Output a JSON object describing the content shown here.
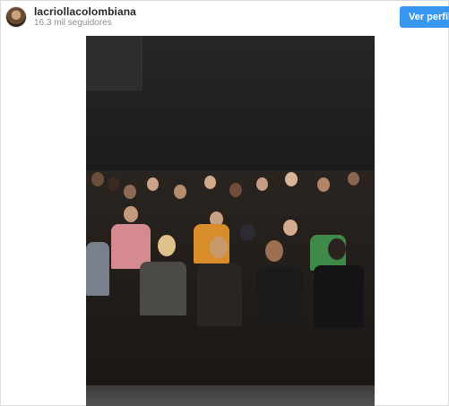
{
  "header": {
    "username": "lacriollacolombiana",
    "followers": "16.3 mil seguidores",
    "profile_button": "Ver perfil"
  },
  "colors": {
    "accent": "#3897f0",
    "username": "#262626",
    "secondary_text": "#8e8e8e"
  },
  "icons": {
    "avatar": "profile-avatar"
  }
}
